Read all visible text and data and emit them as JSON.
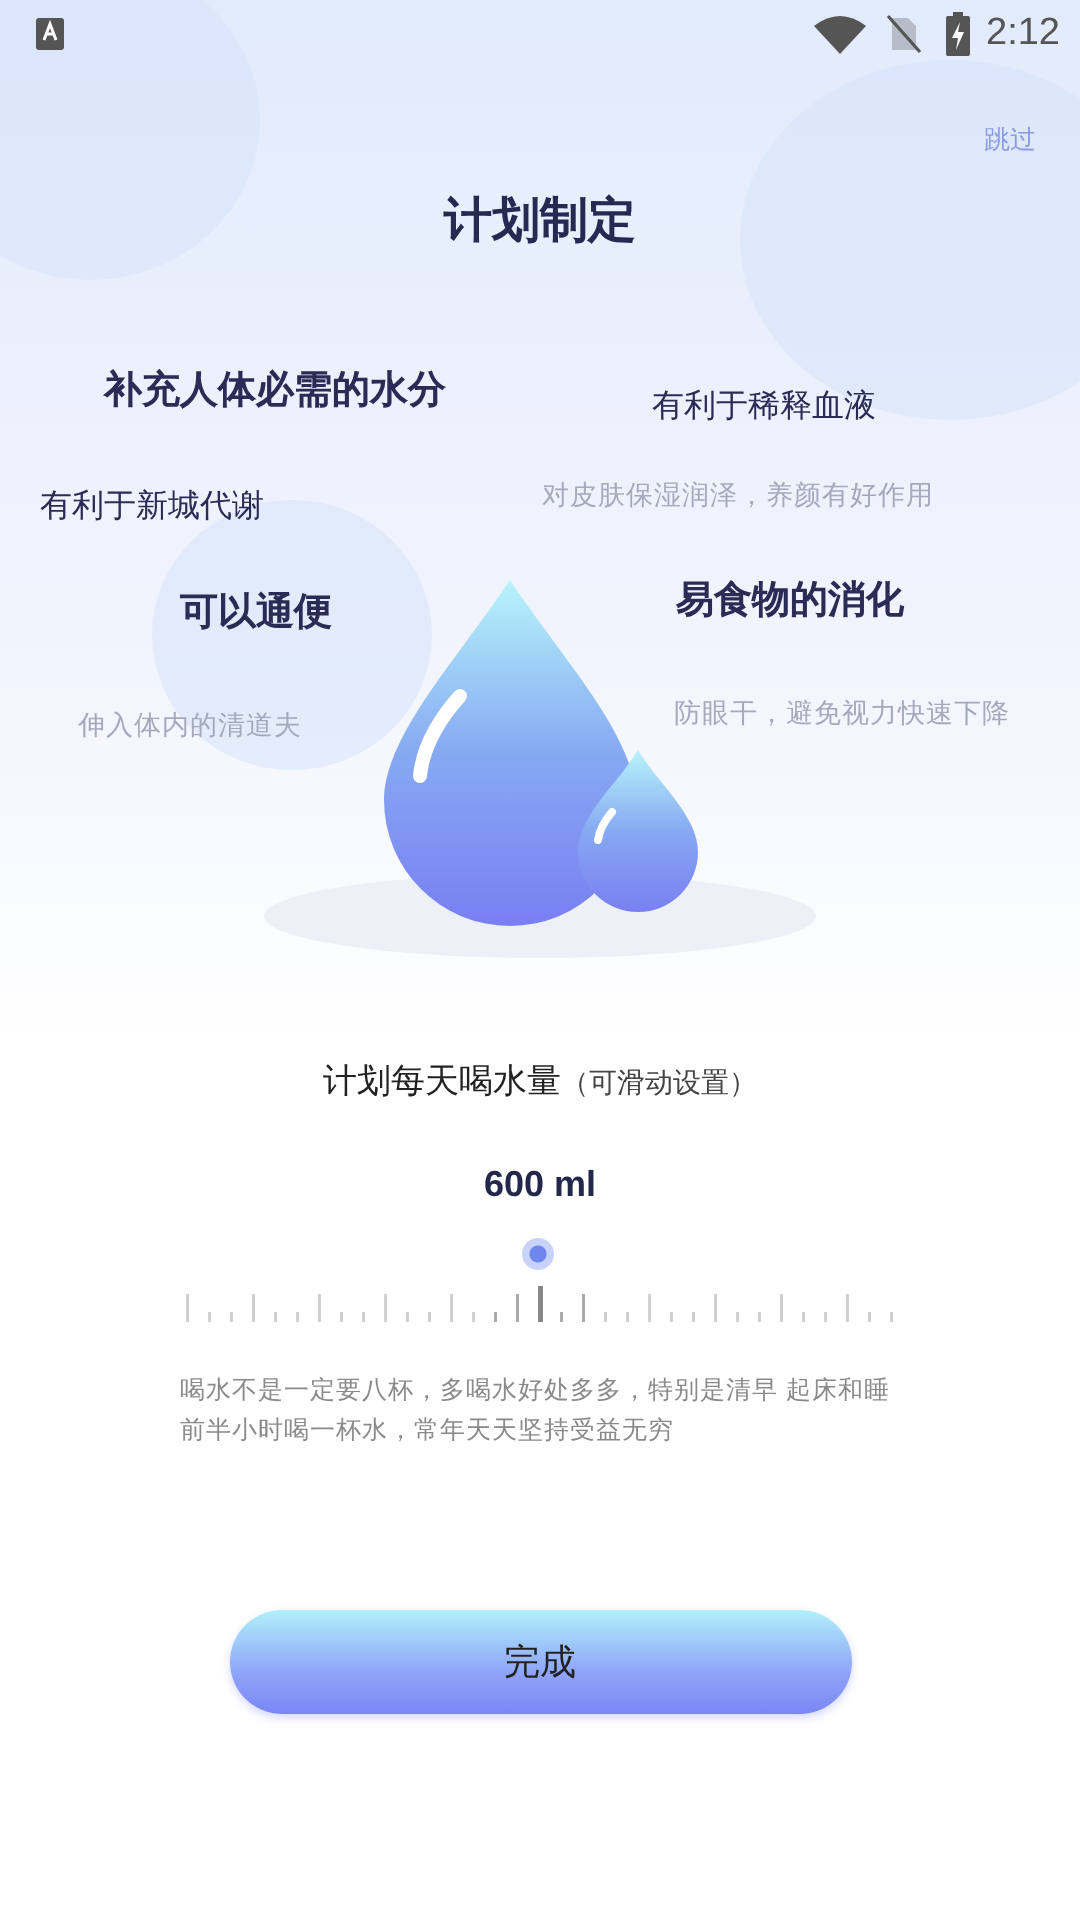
{
  "status_bar": {
    "time": "2:12"
  },
  "skip": "跳过",
  "title": "计划制定",
  "benefits": [
    {
      "text": "补充人体必需的水分",
      "kind": "major"
    },
    {
      "text": "有利于稀释血液",
      "kind": "minor"
    },
    {
      "text": "有利于新城代谢",
      "kind": "minor"
    },
    {
      "text": "对皮肤保湿润泽，养颜有好作用",
      "kind": "faint"
    },
    {
      "text": "可以通便",
      "kind": "major"
    },
    {
      "text": "易食物的消化",
      "kind": "major"
    },
    {
      "text": "伸入体内的清道夫",
      "kind": "faint"
    },
    {
      "text": "防眼干，避免视力快速下降",
      "kind": "faint"
    }
  ],
  "plan": {
    "label": "计划每天喝水量",
    "hint": "（可滑动设置）",
    "value": "600 ml",
    "level": 0.5
  },
  "tip": "喝水不是一定要八杯，多喝水好处多多，特别是清早 起床和睡前半小时喝一杯水，常年天天坚持受益无穷",
  "done_button": "完成"
}
